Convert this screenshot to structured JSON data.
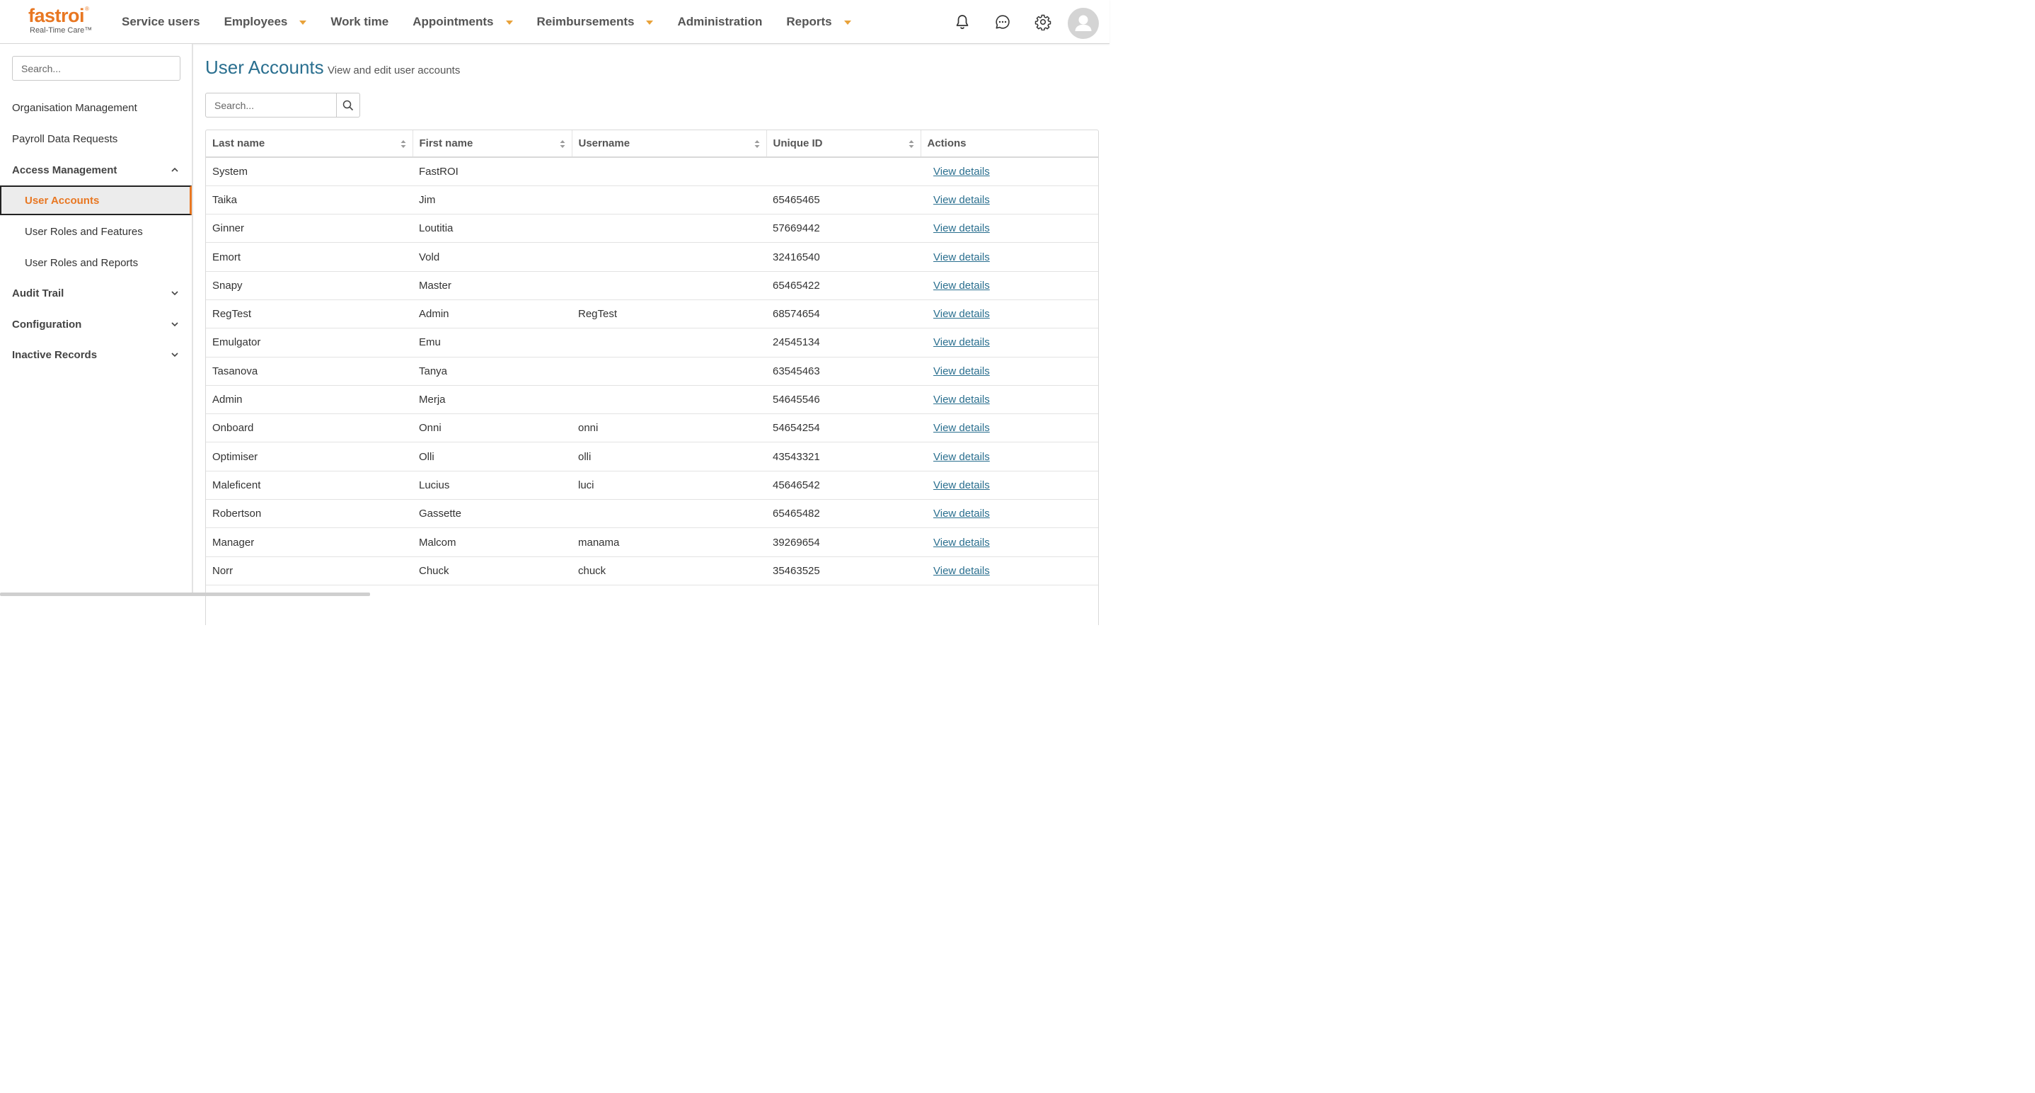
{
  "brand": {
    "name": "fastroi",
    "registered": "®",
    "tagline": "Real-Time Care™",
    "accent": "#e87722"
  },
  "nav": [
    {
      "label": "Service users",
      "dropdown": false
    },
    {
      "label": "Employees",
      "dropdown": true
    },
    {
      "label": "Work time",
      "dropdown": false
    },
    {
      "label": "Appointments",
      "dropdown": true
    },
    {
      "label": "Reimbursements",
      "dropdown": true
    },
    {
      "label": "Administration",
      "dropdown": false
    },
    {
      "label": "Reports",
      "dropdown": true
    }
  ],
  "top_icons": [
    "bell-icon",
    "chat-icon",
    "gear-icon",
    "user-avatar-icon"
  ],
  "sidebar": {
    "search_placeholder": "Search...",
    "items": [
      {
        "label": "Organisation Management"
      },
      {
        "label": "Payroll Data Requests"
      },
      {
        "label": "Access Management",
        "expanded": true
      },
      {
        "label": "User Accounts",
        "active": true
      },
      {
        "label": "User Roles and Features"
      },
      {
        "label": "User Roles and Reports"
      },
      {
        "label": "Audit Trail",
        "expanded": false
      },
      {
        "label": "Configuration",
        "expanded": false
      },
      {
        "label": "Inactive Records",
        "expanded": false
      }
    ]
  },
  "main": {
    "title": "User Accounts",
    "subtitle": "View and edit user accounts",
    "search_placeholder": "Search..."
  },
  "table": {
    "columns": [
      "Last name",
      "First name",
      "Username",
      "Unique ID",
      "Actions"
    ],
    "action_label": "View details",
    "rows": [
      [
        "System",
        "FastROI",
        "",
        ""
      ],
      [
        "Taika",
        "Jim",
        "",
        "65465465"
      ],
      [
        "Ginner",
        "Loutitia",
        "",
        "57669442"
      ],
      [
        "Emort",
        "Vold",
        "",
        "32416540"
      ],
      [
        "Snapy",
        "Master",
        "",
        "65465422"
      ],
      [
        "RegTest",
        "Admin",
        "RegTest",
        "68574654"
      ],
      [
        "Emulgator",
        "Emu",
        "",
        "24545134"
      ],
      [
        "Tasanova",
        "Tanya",
        "",
        "63545463"
      ],
      [
        "Admin",
        "Merja",
        "",
        "54645546"
      ],
      [
        "Onboard",
        "Onni",
        "onni",
        "54654254"
      ],
      [
        "Optimiser",
        "Olli",
        "olli",
        "43543321"
      ],
      [
        "Maleficent",
        "Lucius",
        "luci",
        "45646542"
      ],
      [
        "Robertson",
        "Gassette",
        "",
        "65465482"
      ],
      [
        "Manager",
        "Malcom",
        "manama",
        "39269654"
      ],
      [
        "Norr",
        "Chuck",
        "chuck",
        "35463525"
      ]
    ]
  }
}
